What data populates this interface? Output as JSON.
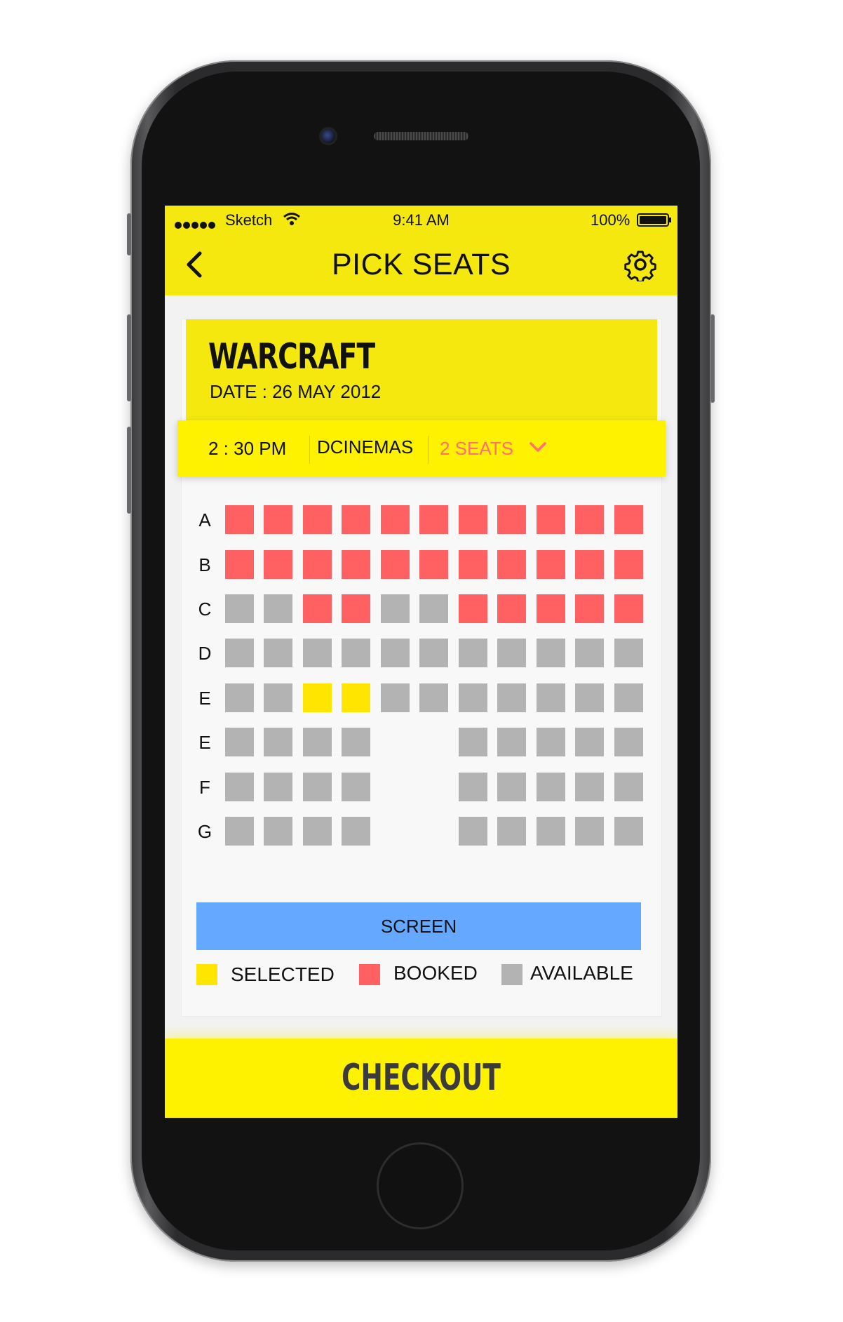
{
  "status_bar": {
    "carrier": "Sketch",
    "time": "9:41 AM",
    "battery": "100%"
  },
  "nav": {
    "title": "PICK SEATS",
    "back_icon": "chevron-left-icon",
    "settings_icon": "gear-icon"
  },
  "movie": {
    "title": "WARCRAFT",
    "date": "DATE : 26 MAY 2012"
  },
  "showtime": {
    "time": "2 : 30 PM",
    "cinema": "DCINEMAS",
    "seats": "2 SEATS"
  },
  "seat_map": {
    "rows": [
      {
        "label": "A",
        "seats": [
          "booked",
          "booked",
          "booked",
          "booked",
          "booked",
          "booked",
          "booked",
          "booked",
          "booked",
          "booked",
          "booked"
        ]
      },
      {
        "label": "B",
        "seats": [
          "booked",
          "booked",
          "booked",
          "booked",
          "booked",
          "booked",
          "booked",
          "booked",
          "booked",
          "booked",
          "booked"
        ]
      },
      {
        "label": "C",
        "seats": [
          "available",
          "available",
          "booked",
          "booked",
          "available",
          "available",
          "booked",
          "booked",
          "booked",
          "booked",
          "booked"
        ]
      },
      {
        "label": "D",
        "seats": [
          "available",
          "available",
          "available",
          "available",
          "available",
          "available",
          "available",
          "available",
          "available",
          "available",
          "available"
        ]
      },
      {
        "label": "E",
        "seats": [
          "available",
          "available",
          "selected",
          "selected",
          "available",
          "available",
          "available",
          "available",
          "available",
          "available",
          "available"
        ]
      },
      {
        "label": "E",
        "seats": [
          "available",
          "available",
          "available",
          "available",
          null,
          null,
          "available",
          "available",
          "available",
          "available",
          "available"
        ]
      },
      {
        "label": "F",
        "seats": [
          "available",
          "available",
          "available",
          "available",
          null,
          null,
          "available",
          "available",
          "available",
          "available",
          "available"
        ]
      },
      {
        "label": "G",
        "seats": [
          "available",
          "available",
          "available",
          "available",
          null,
          null,
          "available",
          "available",
          "available",
          "available",
          "available"
        ]
      }
    ]
  },
  "screen_label": "SCREEN",
  "legend": [
    {
      "key": "selected",
      "label": "SELECTED",
      "color": "#ffe500"
    },
    {
      "key": "booked",
      "label": "BOOKED",
      "color": "#ff6163"
    },
    {
      "key": "available",
      "label": "AVAILABLE",
      "color": "#b3b3b3"
    }
  ],
  "checkout_label": "CHECKOUT",
  "colors": {
    "accent_yellow": "#f4e80f",
    "booked": "#ff6163",
    "available": "#b3b3b3",
    "selected": "#ffe500",
    "screen": "#64a8ff",
    "seats_link": "#ff6f78"
  }
}
